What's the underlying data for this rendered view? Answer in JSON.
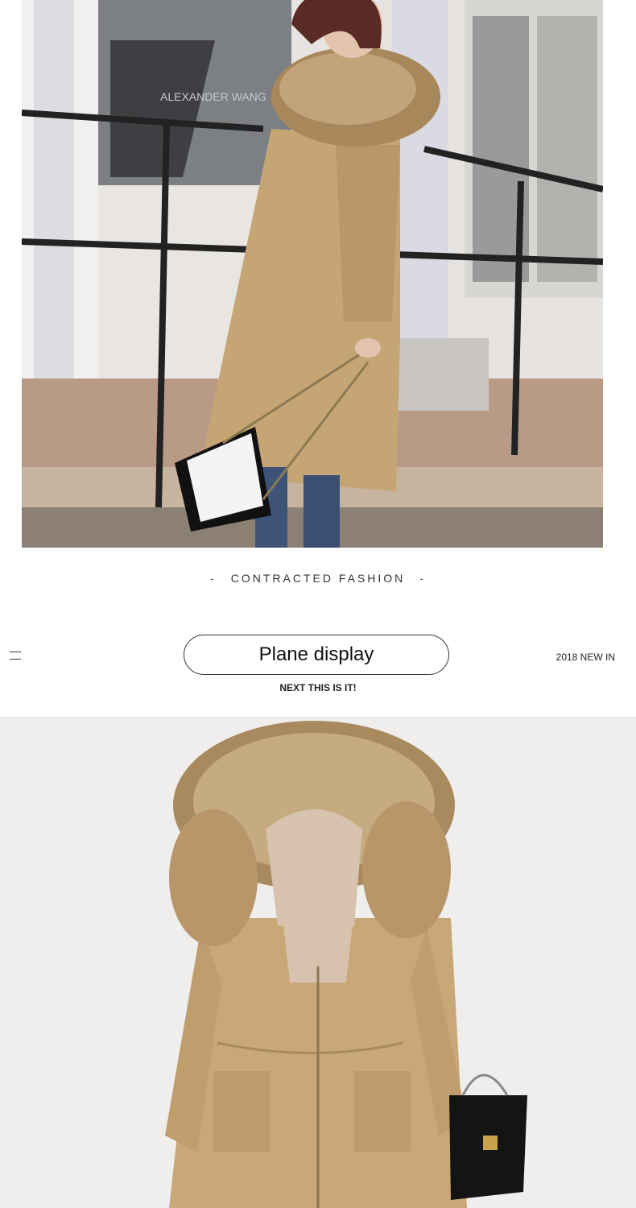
{
  "hero": {
    "storefront_sign": "ALEXANDER WANG",
    "caption_dash_left": "-",
    "caption_text": "CONTRACTED FASHION",
    "caption_dash_right": "-"
  },
  "section": {
    "menu_icon": "menu-icon",
    "button_label": "Plane display",
    "badge": "2018 NEW IN",
    "subheading": "NEXT THIS IS IT!"
  },
  "colors": {
    "coat_khaki": "#c8a877",
    "fur": "#b8966a",
    "railing": "#222222",
    "background": "#ffffff"
  }
}
